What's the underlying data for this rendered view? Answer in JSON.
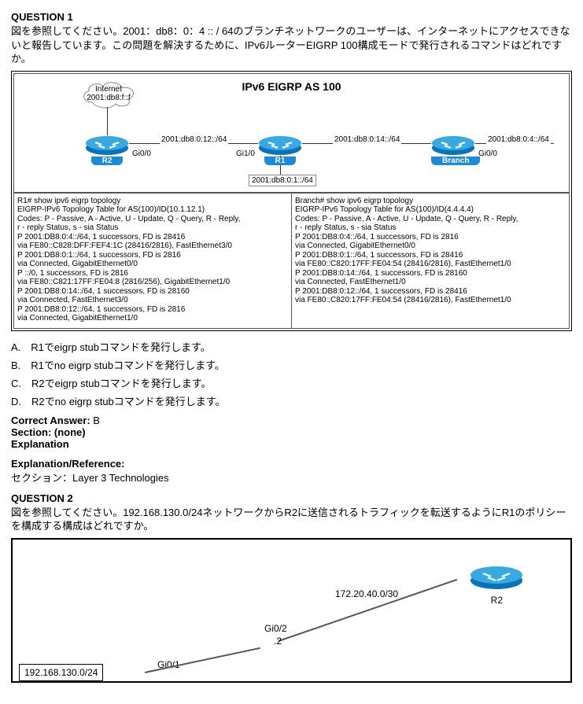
{
  "q1": {
    "heading": "QUESTION 1",
    "text": "図を参照してください。2001：db8：0：4 :: / 64のブランチネットワークのユーザーは、インターネットにアクセスできないと報告しています。この問題を解決するために、IPv6ルーターEIGRP 100構成モードで発行されるコマンドはどれですか。",
    "topo_title": "IPv6 EIGRP AS 100",
    "internet": {
      "line1": "Internet",
      "line2": "2001:db8:f::f"
    },
    "routers": {
      "r2": "R2",
      "r1": "R1",
      "branch": "Branch"
    },
    "ifaces": {
      "r2_gi00": "Gi0/0",
      "r1_gi10": "Gi1/0",
      "branch_gi00": "Gi0/0"
    },
    "nets": {
      "r2_r1": "2001:db8:0:12::/64",
      "r1_below": "2001:db8:0:1::/64",
      "r1_branch": "2001:db8:0:14::/64",
      "branch_right": "2001:db8:0:4::/64"
    },
    "cli_r1": "R1# show ipv6 eigrp topology\nEIGRP-IPv6 Topology Table for AS(100)/ID(10.1.12.1)\nCodes: P - Passive, A - Active, U - Update, Q - Query, R - Reply,\n          r - reply Status, s - sia Status\nP 2001:DB8:0:4::/64, 1 successors, FD is 28416\n          via FE80::C828:DFF:FEF4:1C (28416/2816), FastEthernet3/0\nP 2001:DB8:0:1::/64, 1 successors, FD is 2816\n          via Connected, GigabitEthernet0/0\nP ::/0, 1 successors, FD is 2816\n          via FE80::C821:17FF:FE04:8 (2816/256), GigabitEthernet1/0\nP 2001:DB8:0:14::/64, 1 successors, FD is 28160\n          via Connected, FastEthernet3/0\nP 2001:DB8:0:12::/64, 1 successors, FD is 2816\n          via Connected, GigabitEthernet1/0",
    "cli_branch": "Branch# show ipv6 eigrp topology\nEIGRP-IPv6 Topology Table for AS(100)/ID(4.4.4.4)\nCodes: P - Passive, A - Active, U - Update, Q - Query, R - Reply,\n          r - reply Status, s - sia Status\nP 2001:DB8:0:4::/64, 1 successors, FD is 2816\n          via Connected, GigabitEthernet0/0\nP 2001:DB8:0:1::/64, 1 successors, FD is 28416\n          via FE80::C820:17FF:FE04:54 (28416/2816), FastEthernet1/0\nP 2001:DB8:0:14::/64, 1 successors, FD is 28160\n          via Connected, FastEthernet1/0\nP 2001:DB8:0:12::/64, 1 successors, FD is 28416\n          via FE80::C820:17FF:FE04:54 (28416/2816), FastEthernet1/0",
    "choices": {
      "a": "A.　R1でeigrp stubコマンドを発行します。",
      "b": "B.　R1でno eigrp stubコマンドを発行します。",
      "c": "C.　R2でeigrp stubコマンドを発行します。",
      "d": "D.　R2でno eigrp stubコマンドを発行します。"
    },
    "answer_label": "Correct Answer:",
    "answer_value": " B",
    "section_label": "Section: (none)",
    "explanation_label": "Explanation",
    "expref_label": "Explanation/Reference:",
    "expref_text": "セクション：Layer 3 Technologies"
  },
  "q2": {
    "heading": "QUESTION 2",
    "text": "図を参照してください。192.168.130.0/24ネットワークからR2に送信されるトラフィックを転送するようにR1のポリシーを構成する構成はどれですか。",
    "net_wan": "172.20.40.0/30",
    "r2": "R2",
    "gi02": "Gi0/2",
    "dot2": ".2",
    "gi01": "Gi0/1",
    "box_net": "192.168.130.0/24"
  }
}
